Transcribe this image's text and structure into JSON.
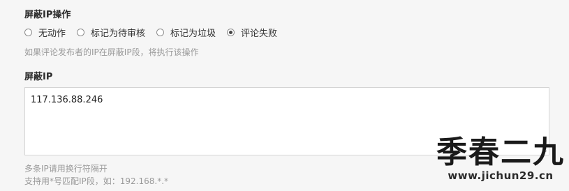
{
  "block_action": {
    "title": "屏蔽IP操作",
    "options": [
      {
        "label": "无动作",
        "checked": false
      },
      {
        "label": "标记为待审核",
        "checked": false
      },
      {
        "label": "标记为垃圾",
        "checked": false
      },
      {
        "label": "评论失败",
        "checked": true
      }
    ],
    "hint": "如果评论发布者的IP在屏蔽IP段，将执行该操作"
  },
  "block_ip": {
    "title": "屏蔽IP",
    "value": "117.136.88.246",
    "hint_line1": "多条IP请用换行符隔开",
    "hint_line2": "支持用*号匹配IP段，如：192.168.*.*"
  },
  "watermark": {
    "title": "季春二九",
    "url": "www.jichun29.cn"
  }
}
